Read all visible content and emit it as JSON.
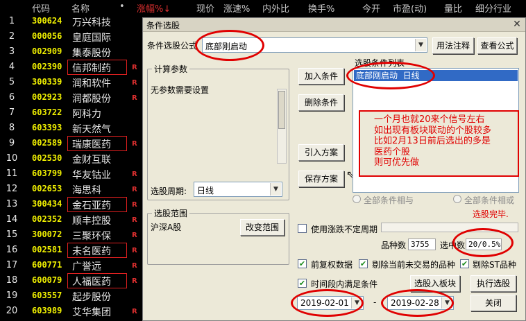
{
  "header": {
    "columns": [
      "代码",
      "名称",
      "•",
      "涨幅%↓",
      "现价",
      "涨速%",
      "内外比",
      "换手%",
      "今开",
      "市盈(动)",
      "量比",
      "细分行业"
    ]
  },
  "stocks": [
    {
      "idx": "1",
      "code": "300624",
      "name": "万兴科技",
      "r": "",
      "highlight": false
    },
    {
      "idx": "2",
      "code": "000056",
      "name": "皇庭国际",
      "r": "",
      "highlight": false
    },
    {
      "idx": "3",
      "code": "002909",
      "name": "集泰股份",
      "r": "",
      "highlight": false
    },
    {
      "idx": "4",
      "code": "002390",
      "name": "信邦制药",
      "r": "R",
      "highlight": true
    },
    {
      "idx": "5",
      "code": "300339",
      "name": "润和软件",
      "r": "R",
      "highlight": false
    },
    {
      "idx": "6",
      "code": "002923",
      "name": "润都股份",
      "r": "R",
      "highlight": false
    },
    {
      "idx": "7",
      "code": "603722",
      "name": "阿科力",
      "r": "",
      "highlight": false
    },
    {
      "idx": "8",
      "code": "603393",
      "name": "新天然气",
      "r": "",
      "highlight": false
    },
    {
      "idx": "9",
      "code": "002589",
      "name": "瑞康医药",
      "r": "R",
      "highlight": true
    },
    {
      "idx": "10",
      "code": "002530",
      "name": "金财互联",
      "r": "",
      "highlight": false
    },
    {
      "idx": "11",
      "code": "603799",
      "name": "华友钴业",
      "r": "R",
      "highlight": false
    },
    {
      "idx": "12",
      "code": "002653",
      "name": "海思科",
      "r": "R",
      "highlight": false
    },
    {
      "idx": "13",
      "code": "300434",
      "name": "金石亚药",
      "r": "R",
      "highlight": true
    },
    {
      "idx": "14",
      "code": "002352",
      "name": "顺丰控股",
      "r": "R",
      "highlight": false
    },
    {
      "idx": "15",
      "code": "300072",
      "name": "三聚环保",
      "r": "R",
      "highlight": false
    },
    {
      "idx": "16",
      "code": "002581",
      "name": "未名医药",
      "r": "R",
      "highlight": true
    },
    {
      "idx": "17",
      "code": "600771",
      "name": "广誉远",
      "r": "R",
      "highlight": false
    },
    {
      "idx": "18",
      "code": "600079",
      "name": "人福医药",
      "r": "R",
      "highlight": true
    },
    {
      "idx": "19",
      "code": "603557",
      "name": "起步股份",
      "r": "",
      "highlight": false
    },
    {
      "idx": "20",
      "code": "603989",
      "name": "艾华集团",
      "r": "R",
      "highlight": false
    }
  ],
  "dialog": {
    "title": "条件选股",
    "formula_label": "条件选股公式",
    "formula_value": "底部刚启动",
    "usage_btn": "用法注释",
    "view_formula_btn": "查看公式",
    "calc_params_title": "计算参数",
    "no_params_text": "无参数需要设置",
    "period_label": "选股周期:",
    "period_value": "日线",
    "add_condition_btn": "加入条件",
    "delete_condition_btn": "删除条件",
    "import_plan_btn": "引入方案",
    "save_plan_btn": "保存方案",
    "condition_list_title": "选股条件列表",
    "condition_item": "底部刚启动  日线",
    "annotation_lines": [
      "一个月也就20来个信号左右",
      "如出现有板块联动的个股较多",
      "比如2月13日前后选出的多是",
      "医药个股",
      "则可优先做"
    ],
    "radio_all_and": "全部条件相与",
    "radio_all_or": "全部条件相或",
    "status_text": "选股完毕.",
    "scope_title": "选股范围",
    "scope_value": "沪深A股",
    "change_scope_btn": "改变范围",
    "use_uncertain_label": "使用涨跌不定周期",
    "stock_count_label": "品种数",
    "stock_count_value": "3755",
    "selected_count_label": "选中数",
    "selected_count_value": "20/0.5%",
    "pre_adjust_label": "前复权数据",
    "exclude_untraded_label": "剔除当前未交易的品种",
    "exclude_st_label": "剔除ST品种",
    "time_range_label": "时间段内满足条件",
    "select_to_sector_btn": "选股入板块",
    "execute_btn": "执行选股",
    "start_date": "2019-02-01",
    "date_separator": "-",
    "end_date": "2019-02-28",
    "close_btn": "关闭"
  },
  "colors": {
    "code": "#f0f000",
    "annotation": "#e00000",
    "selected_item": "#316ac5"
  }
}
